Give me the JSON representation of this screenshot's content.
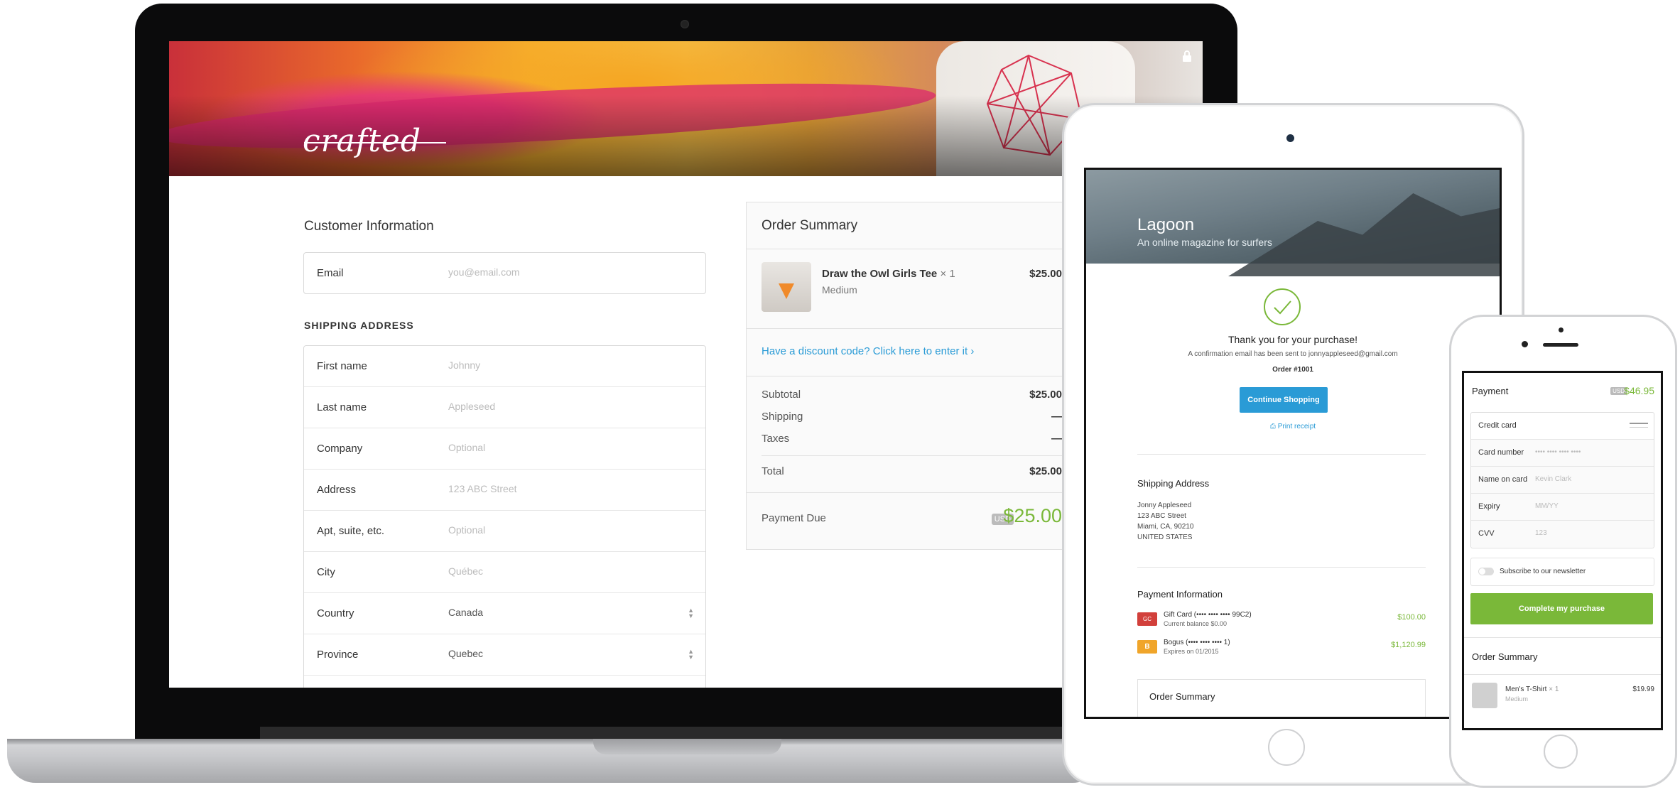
{
  "laptop": {
    "brand_logo": "crafted",
    "customer_info": {
      "title": "Customer Information",
      "email_label": "Email",
      "email_placeholder": "you@email.com"
    },
    "shipping": {
      "title": "SHIPPING ADDRESS",
      "fields": [
        {
          "label": "First name",
          "value": "Johnny",
          "type": "input"
        },
        {
          "label": "Last name",
          "value": "Appleseed",
          "type": "input"
        },
        {
          "label": "Company",
          "value": "Optional",
          "type": "input"
        },
        {
          "label": "Address",
          "value": "123 ABC Street",
          "type": "input"
        },
        {
          "label": "Apt, suite, etc.",
          "value": "Optional",
          "type": "input"
        },
        {
          "label": "City",
          "value": "Québec",
          "type": "input"
        },
        {
          "label": "Country",
          "value": "Canada",
          "type": "select"
        },
        {
          "label": "Province",
          "value": "Quebec",
          "type": "select"
        }
      ]
    },
    "order_summary": {
      "title": "Order Summary",
      "item_name": "Draw the Owl Girls Tee",
      "item_qty": "× 1",
      "item_variant": "Medium",
      "item_price": "$25.00",
      "discount_link": "Have a discount code? Click here to enter it",
      "subtotal_label": "Subtotal",
      "subtotal_value": "$25.00",
      "shipping_label": "Shipping",
      "shipping_value": "—",
      "taxes_label": "Taxes",
      "taxes_value": "—",
      "total_label": "Total",
      "total_value": "$25.00",
      "payment_due_label": "Payment Due",
      "currency": "USD",
      "payment_due_value": "$25.00"
    }
  },
  "tablet": {
    "store_name": "Lagoon",
    "tagline": "An online magazine for surfers",
    "thanks": "Thank you for your purchase!",
    "confirmation": "A confirmation email has been sent to jonnyappleseed@gmail.com",
    "order_number": "Order #1001",
    "continue_button": "Continue Shopping",
    "print_receipt": "Print receipt",
    "shipping_title": "Shipping Address",
    "address_lines": [
      "Jonny Appleseed",
      "123 ABC Street",
      "Miami, CA, 90210",
      "UNITED STATES"
    ],
    "payment_title": "Payment Information",
    "payments": [
      {
        "name": "Gift Card (•••• •••• •••• 99C2)",
        "sub": "Current balance $0.00",
        "amount": "$100.00",
        "icon": "gift-card-icon",
        "badge": "GC"
      },
      {
        "name": "Bogus (•••• •••• •••• 1)",
        "sub": "Expires on 01/2015",
        "amount": "$1,120.99",
        "icon": "bogus-card-icon",
        "badge": "B"
      }
    ],
    "order_summary_title": "Order Summary"
  },
  "phone": {
    "payment_title": "Payment",
    "currency": "USD",
    "total": "$46.95",
    "method": "Credit card",
    "fields": [
      {
        "label": "Card number",
        "placeholder": "•••• •••• •••• ••••"
      },
      {
        "label": "Name on card",
        "placeholder": "Kevin Clark"
      },
      {
        "label": "Expiry",
        "placeholder": "MM/YY"
      },
      {
        "label": "CVV",
        "placeholder": "123"
      }
    ],
    "newsletter": "Subscribe to our newsletter",
    "complete_button": "Complete my purchase",
    "order_summary_title": "Order Summary",
    "item_name": "Men's T-Shirt",
    "item_qty": "× 1",
    "item_variant": "Medium",
    "item_price": "$19.99"
  },
  "colors": {
    "accent_green": "#7ab839",
    "link_blue": "#2a9bd6",
    "button_blue": "#2a9bd6"
  }
}
